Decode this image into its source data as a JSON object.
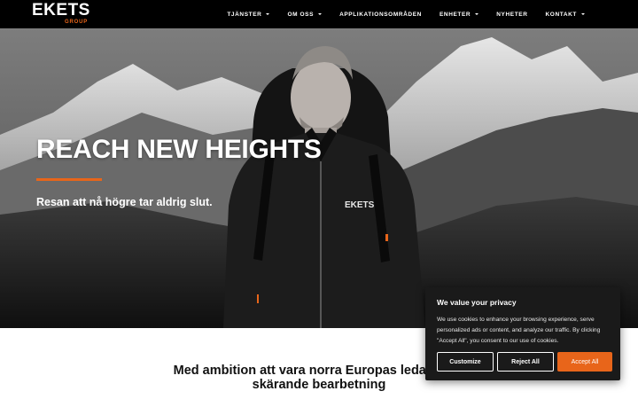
{
  "header": {
    "logo_main": "EKETS",
    "logo_sub": "GROUP",
    "nav": [
      {
        "label": "TJÄNSTER",
        "dropdown": true
      },
      {
        "label": "OM OSS",
        "dropdown": true
      },
      {
        "label": "APPLIKATIONSOMRÅDEN",
        "dropdown": false
      },
      {
        "label": "ENHETER",
        "dropdown": true
      },
      {
        "label": "NYHETER",
        "dropdown": false
      },
      {
        "label": "KONTAKT",
        "dropdown": true
      }
    ]
  },
  "hero": {
    "title": "REACH NEW HEIGHTS",
    "subtitle": "Resan att nå högre tar aldrig slut.",
    "jacket_logo": "EKETS"
  },
  "intro": {
    "line1": "Med ambition att vara norra Europas ledande fö",
    "line2": "skärande bearbetning"
  },
  "cookie": {
    "title": "We value your privacy",
    "text": "We use cookies to enhance your browsing experience, serve personalized ads or content, and analyze our traffic. By clicking \"Accept All\", you consent to our use of cookies.",
    "customize_label": "Customize",
    "reject_label": "Reject All",
    "accept_label": "Accept All"
  },
  "colors": {
    "accent": "#e8651a",
    "header_bg": "#000000",
    "banner_bg": "#1a1a1a"
  }
}
